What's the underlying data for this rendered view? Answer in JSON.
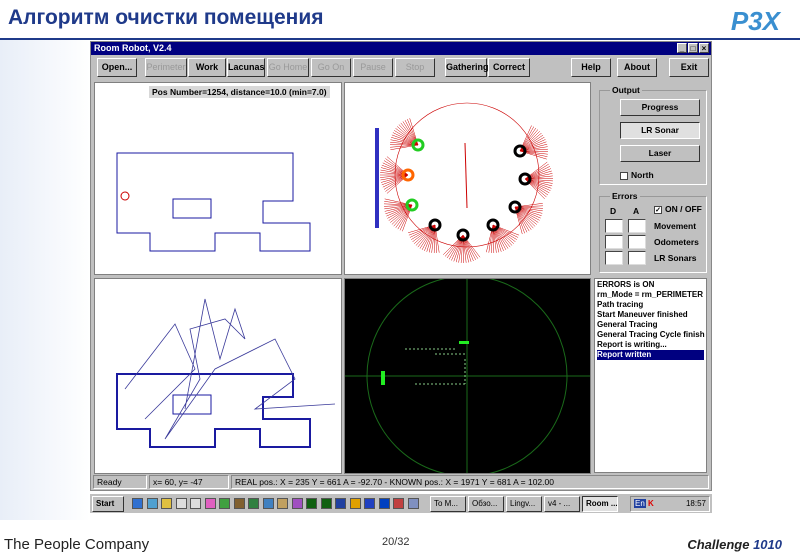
{
  "slide": {
    "title": "Алгоритм очистки помещения",
    "logo": "P3X",
    "footer_left": "The People Company",
    "page": "20/32",
    "footer_right_prefix": "Challenge ",
    "footer_right_num": "1010"
  },
  "window": {
    "title": "Room Robot, V2.4",
    "min": "_",
    "max": "□",
    "close": "×"
  },
  "toolbar": [
    {
      "label": "Open...",
      "enabled": true
    },
    {
      "label": "Perimeter",
      "enabled": false
    },
    {
      "label": "Work",
      "enabled": true
    },
    {
      "label": "Lacunas",
      "enabled": true
    },
    {
      "label": "Go Home",
      "enabled": false
    },
    {
      "label": "Go On",
      "enabled": false
    },
    {
      "label": "Pause",
      "enabled": false
    },
    {
      "label": "Stop",
      "enabled": false
    },
    {
      "label": "Gathering",
      "enabled": true
    },
    {
      "label": "Correct",
      "enabled": true
    },
    {
      "label": "Help",
      "enabled": true
    },
    {
      "label": "About",
      "enabled": true
    },
    {
      "label": "Exit",
      "enabled": true
    }
  ],
  "map": {
    "pos_text": "Pos Number=1254, distance=10.0 (min=7.0)"
  },
  "output": {
    "label": "Output",
    "progress": "Progress",
    "lr_sonar": "LR Sonar",
    "laser": "Laser",
    "north": "North"
  },
  "errors": {
    "label": "Errors",
    "d": "D",
    "a": "A",
    "onoff": "ON / OFF",
    "check": "✓",
    "movement": "Movement",
    "odometers": "Odometers",
    "lr_sonars": "LR Sonars"
  },
  "log": [
    "ERRORS is ON",
    "rm_Mode = rm_PERIMETER",
    "Path tracing",
    "Start Maneuver finished",
    "General Tracing",
    "General Tracing Cycle finish",
    "Report is writing...",
    "Report written"
  ],
  "status": {
    "state": "Ready",
    "coords": "x=  60, y= -47",
    "pos": "REAL pos.: X = 235 Y = 661 A = -92.70 - KNOWN pos.: X = 1971 Y = 681 A = 102.00"
  },
  "taskbar": {
    "start": "Start",
    "tasks": [
      "To M...",
      "Обзо...",
      "Lingv...",
      "v4 - ...",
      "Room ..."
    ],
    "clock": "18:57",
    "lang": "En"
  }
}
